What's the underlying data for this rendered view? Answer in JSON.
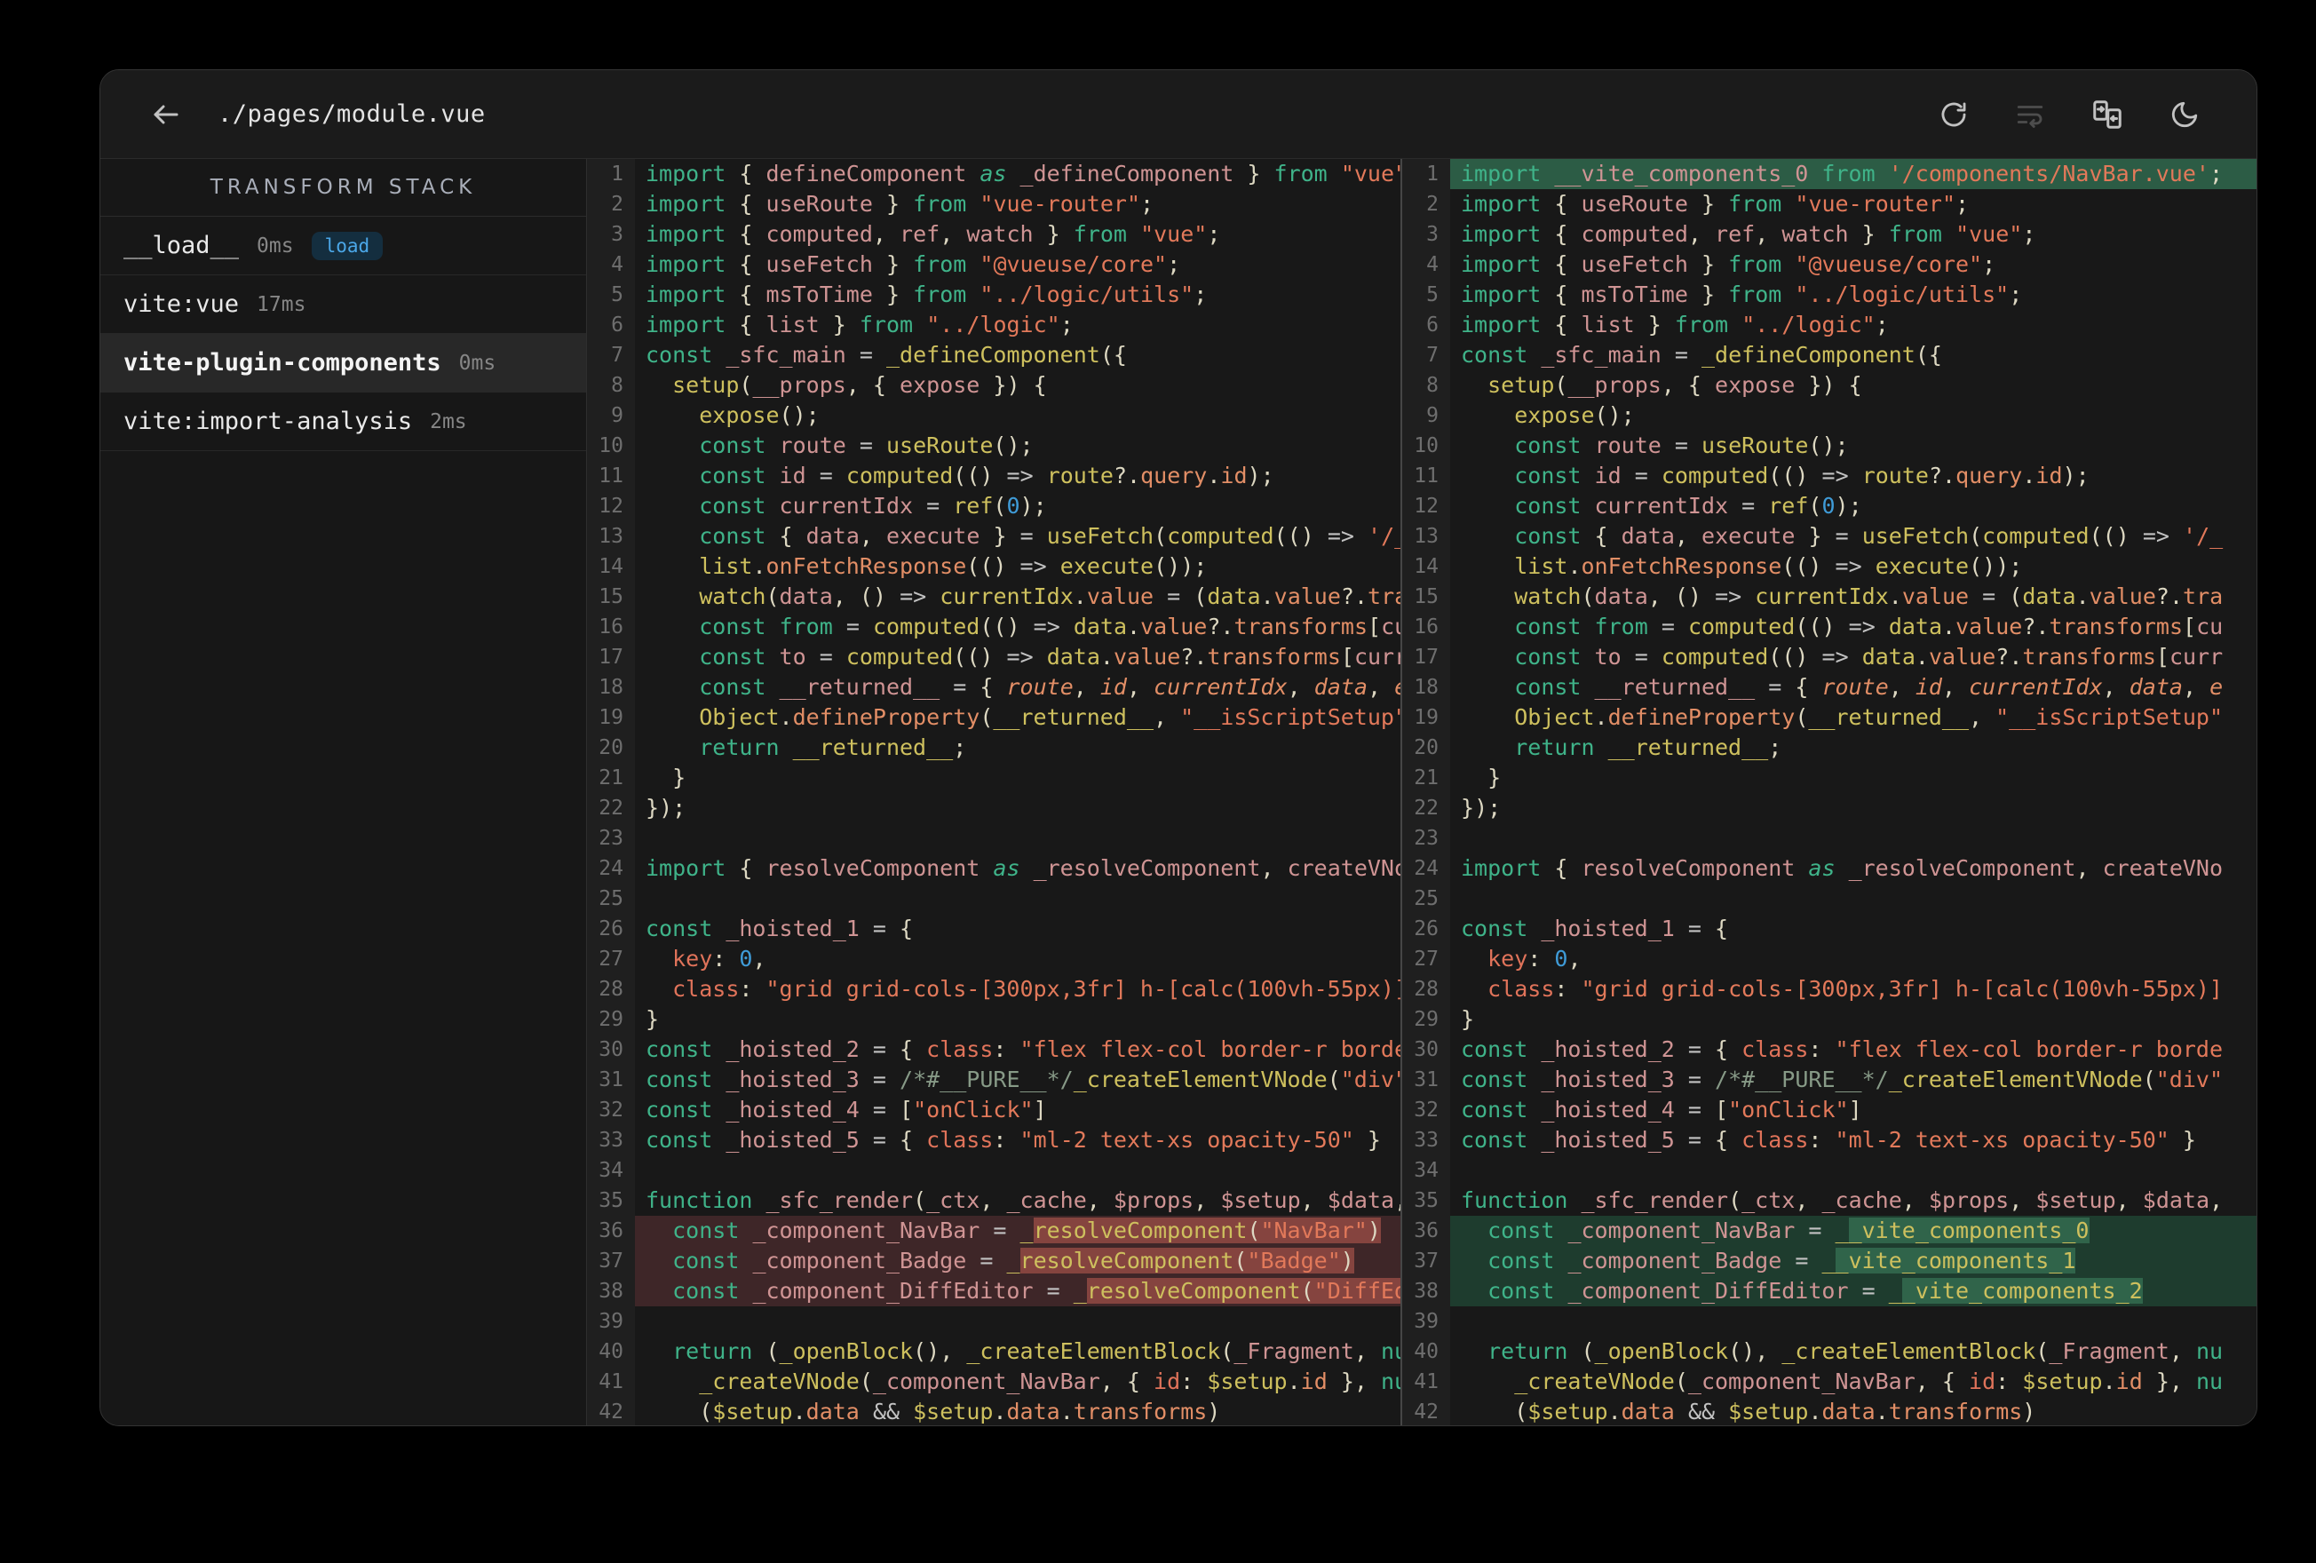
{
  "header": {
    "title": "./pages/module.vue",
    "toolbar": [
      {
        "name": "refresh",
        "disabled": false
      },
      {
        "name": "wrap-lines",
        "disabled": true
      },
      {
        "name": "side-by-side-diff",
        "disabled": false
      },
      {
        "name": "dark-mode",
        "disabled": false
      }
    ]
  },
  "sidebar": {
    "header": "TRANSFORM STACK",
    "items": [
      {
        "name": "__load__",
        "time": "0ms",
        "badge": "load",
        "selected": false
      },
      {
        "name": "vite:vue",
        "time": "17ms",
        "badge": null,
        "selected": false
      },
      {
        "name": "vite-plugin-components",
        "time": "0ms",
        "badge": null,
        "selected": true
      },
      {
        "name": "vite:import-analysis",
        "time": "2ms",
        "badge": null,
        "selected": false
      }
    ]
  },
  "diff": {
    "left_lines": [
      "import { defineComponent as _defineComponent } from \"vue\";",
      "import { useRoute } from \"vue-router\";",
      "import { computed, ref, watch } from \"vue\";",
      "import { useFetch } from \"@vueuse/core\";",
      "import { msToTime } from \"../logic/utils\";",
      "import { list } from \"../logic\";",
      "const _sfc_main = _defineComponent({",
      "  setup(__props, { expose }) {",
      "    expose();",
      "    const route = useRoute();",
      "    const id = computed(() => route?.query.id);",
      "    const currentIdx = ref(0);",
      "    const { data, execute } = useFetch(computed(() => '/_",
      "    list.onFetchResponse(() => execute());",
      "    watch(data, () => currentIdx.value = (data.value?.tra",
      "    const from = computed(() => data.value?.transforms[cu",
      "    const to = computed(() => data.value?.transforms[curr",
      "    const __returned__ = { route, id, currentIdx, data, e",
      "    Object.defineProperty(__returned__, \"__isScriptSetup\"",
      "    return __returned__;",
      "  }",
      "});",
      "",
      "import { resolveComponent as _resolveComponent, createVNo",
      "",
      "const _hoisted_1 = {",
      "  key: 0,",
      "  class: \"grid grid-cols-[300px,3fr] h-[calc(100vh-55px)]",
      "}",
      "const _hoisted_2 = { class: \"flex flex-col border-r borde",
      "const _hoisted_3 = /*#__PURE__*/_createElementVNode(\"div\"",
      "const _hoisted_4 = [\"onClick\"]",
      "const _hoisted_5 = { class: \"ml-2 text-xs opacity-50\" }",
      "",
      "function _sfc_render(_ctx, _cache, $props, $setup, $data,",
      "  const _component_NavBar = _resolveComponent(\"NavBar\")",
      "  const _component_Badge = _resolveComponent(\"Badge\")",
      "  const _component_DiffEditor = _resolveComponent(\"DiffEd",
      "",
      "  return (_openBlock(), _createElementBlock(_Fragment, nu",
      "    _createVNode(_component_NavBar, { id: $setup.id }, nu",
      "    ($setup.data && $setup.data.transforms)"
    ],
    "right_lines": [
      "import __vite_components_0 from '/components/NavBar.vue';",
      "import { useRoute } from \"vue-router\";",
      "import { computed, ref, watch } from \"vue\";",
      "import { useFetch } from \"@vueuse/core\";",
      "import { msToTime } from \"../logic/utils\";",
      "import { list } from \"../logic\";",
      "const _sfc_main = _defineComponent({",
      "  setup(__props, { expose }) {",
      "    expose();",
      "    const route = useRoute();",
      "    const id = computed(() => route?.query.id);",
      "    const currentIdx = ref(0);",
      "    const { data, execute } = useFetch(computed(() => '/_",
      "    list.onFetchResponse(() => execute());",
      "    watch(data, () => currentIdx.value = (data.value?.tra",
      "    const from = computed(() => data.value?.transforms[cu",
      "    const to = computed(() => data.value?.transforms[curr",
      "    const __returned__ = { route, id, currentIdx, data, e",
      "    Object.defineProperty(__returned__, \"__isScriptSetup\"",
      "    return __returned__;",
      "  }",
      "});",
      "",
      "import { resolveComponent as _resolveComponent, createVNo",
      "",
      "const _hoisted_1 = {",
      "  key: 0,",
      "  class: \"grid grid-cols-[300px,3fr] h-[calc(100vh-55px)]",
      "}",
      "const _hoisted_2 = { class: \"flex flex-col border-r borde",
      "const _hoisted_3 = /*#__PURE__*/_createElementVNode(\"div\"",
      "const _hoisted_4 = [\"onClick\"]",
      "const _hoisted_5 = { class: \"ml-2 text-xs opacity-50\" }",
      "",
      "function _sfc_render(_ctx, _cache, $props, $setup, $data,",
      "  const _component_NavBar = __vite_components_0",
      "  const _component_Badge = __vite_components_1",
      "  const _component_DiffEditor = __vite_components_2",
      "",
      "  return (_openBlock(), _createElementBlock(_Fragment, nu",
      "    _createVNode(_component_NavBar, { id: $setup.id }, nu",
      "    ($setup.data && $setup.data.transforms)"
    ],
    "left_marks": {
      "36": {
        "kind": "removed",
        "hl": "resolveComponent(\"NavBar\")"
      },
      "37": {
        "kind": "removed",
        "hl": "resolveComponent(\"Badge\")"
      },
      "38": {
        "kind": "removed",
        "hl": "resolveComponent(\"DiffEd"
      }
    },
    "right_marks": {
      "1": {
        "kind": "added-line",
        "hl": null
      },
      "36": {
        "kind": "added",
        "hl": "_vite_components_0"
      },
      "37": {
        "kind": "added",
        "hl": "_vite_components_1"
      },
      "38": {
        "kind": "added",
        "hl": "_vite_components_2"
      }
    }
  },
  "colors": {
    "badge_text": "#4ba7e8",
    "badge_bg": "#142e3f",
    "diff_removed_row": "#3e2628",
    "diff_removed_token": "#85443f",
    "diff_added_row": "#1e3c2e",
    "diff_added_token": "#30644a",
    "diff_added_full_line": "#2c5c45",
    "keyword": "#3fb389",
    "string": "#e2795a",
    "function": "#cec05e",
    "identifier": "#cf9494",
    "number": "#3f9bd7"
  }
}
